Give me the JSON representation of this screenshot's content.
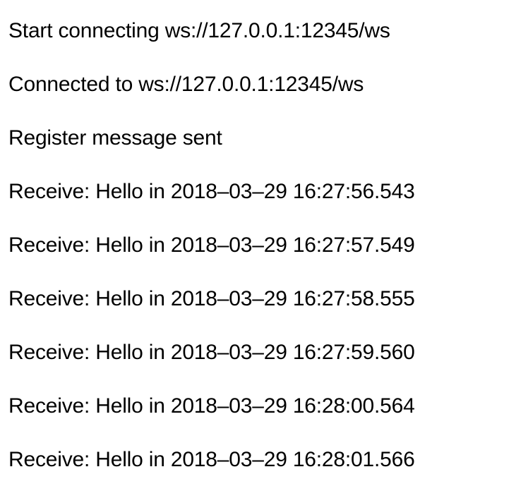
{
  "log": {
    "lines": [
      "Start connecting ws://127.0.0.1:12345/ws",
      "Connected to ws://127.0.0.1:12345/ws",
      "Register message sent",
      "Receive: Hello in 2018–03–29 16:27:56.543",
      "Receive: Hello in 2018–03–29 16:27:57.549",
      "Receive: Hello in 2018–03–29 16:27:58.555",
      "Receive: Hello in 2018–03–29 16:27:59.560",
      "Receive: Hello in 2018–03–29 16:28:00.564",
      "Receive: Hello in 2018–03–29 16:28:01.566"
    ]
  }
}
